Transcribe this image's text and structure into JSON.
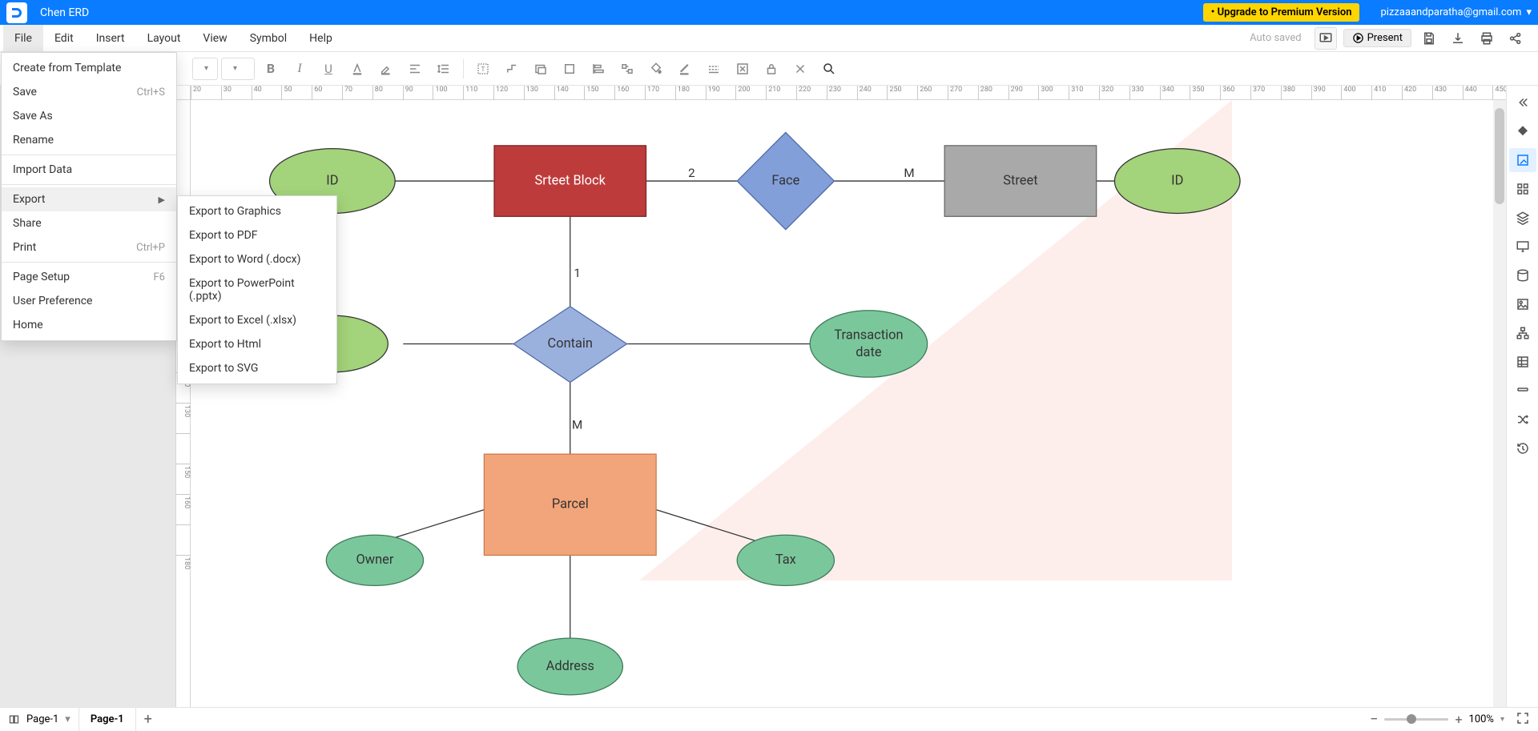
{
  "header": {
    "title": "Chen ERD",
    "upgrade": "• Upgrade to Premium Version",
    "email": "pizzaaandparatha@gmail.com"
  },
  "menubar": {
    "items": [
      "File",
      "Edit",
      "Insert",
      "Layout",
      "View",
      "Symbol",
      "Help"
    ],
    "autosaved": "Auto saved",
    "present": "Present"
  },
  "file_menu": {
    "items": [
      {
        "label": "Create from Template"
      },
      {
        "label": "Save",
        "shortcut": "Ctrl+S"
      },
      {
        "label": "Save As"
      },
      {
        "label": "Rename"
      },
      {
        "sep": true
      },
      {
        "label": "Import Data"
      },
      {
        "sep": true
      },
      {
        "label": "Export",
        "submenu": true,
        "hl": true
      },
      {
        "label": "Share"
      },
      {
        "label": "Print",
        "shortcut": "Ctrl+P"
      },
      {
        "sep": true
      },
      {
        "label": "Page Setup",
        "shortcut": "F6"
      },
      {
        "label": "User Preference"
      },
      {
        "label": "Home"
      }
    ]
  },
  "export_menu": {
    "items": [
      "Export to Graphics",
      "Export to PDF",
      "Export to Word (.docx)",
      "Export to PowerPoint (.pptx)",
      "Export to Excel (.xlsx)",
      "Export to Html",
      "Export to SVG"
    ]
  },
  "ruler": {
    "h_start": 20,
    "h_step": 10,
    "h_count": 120,
    "v_values": [
      120,
      130,
      150,
      160,
      180
    ]
  },
  "diagram": {
    "nodes": {
      "id1": "ID",
      "street_block": "Srteet Block",
      "face": "Face",
      "street": "Street",
      "id2": "ID",
      "contain": "Contain",
      "transaction_date_l1": "Transaction",
      "transaction_date_l2": "date",
      "parcel": "Parcel",
      "owner": "Owner",
      "tax": "Tax",
      "address": "Address"
    },
    "edge_labels": {
      "two": "2",
      "m1": "M",
      "one": "1",
      "m2": "M"
    }
  },
  "bottombar": {
    "pages_select": "Page-1",
    "page_tab": "Page-1",
    "zoom": "100%"
  }
}
